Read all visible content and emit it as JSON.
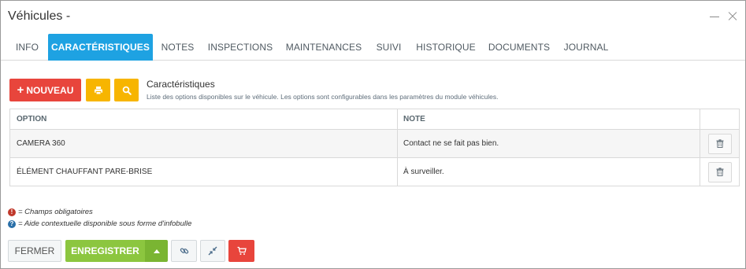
{
  "window": {
    "title": "Véhicules -"
  },
  "tabs": [
    {
      "label": "INFO"
    },
    {
      "label": "CARACTÉRISTIQUES",
      "active": true
    },
    {
      "label": "NOTES"
    },
    {
      "label": "INSPECTIONS"
    },
    {
      "label": "MAINTENANCES"
    },
    {
      "label": "SUIVI"
    },
    {
      "label": "HISTORIQUE"
    },
    {
      "label": "DOCUMENTS"
    },
    {
      "label": "JOURNAL"
    }
  ],
  "toolbar": {
    "new_label": "NOUVEAU",
    "print_icon": "print-icon",
    "search_icon": "search-icon"
  },
  "section": {
    "title": "Caractéristiques",
    "description": "Liste des options disponibles sur le véhicule. Les options sont configurables dans les paramètres du module véhicules."
  },
  "table": {
    "columns": [
      "OPTION",
      "NOTE",
      ""
    ],
    "rows": [
      {
        "option": "CAMERA 360",
        "note": "Contact ne se fait pas bien."
      },
      {
        "option": "ÉLÉMENT CHAUFFANT PARE-BRISE",
        "note": "À surveiller."
      }
    ]
  },
  "legend": {
    "required": "= Champs obligatoires",
    "help": "= Aide contextuelle disponible sous forme d'infobulle"
  },
  "footer": {
    "close_label": "FERMER",
    "save_label": "ENREGISTRER"
  },
  "colors": {
    "accent": "#1ea2e2",
    "danger": "#e8453c",
    "warning": "#f7b500",
    "success": "#8cc63f"
  }
}
